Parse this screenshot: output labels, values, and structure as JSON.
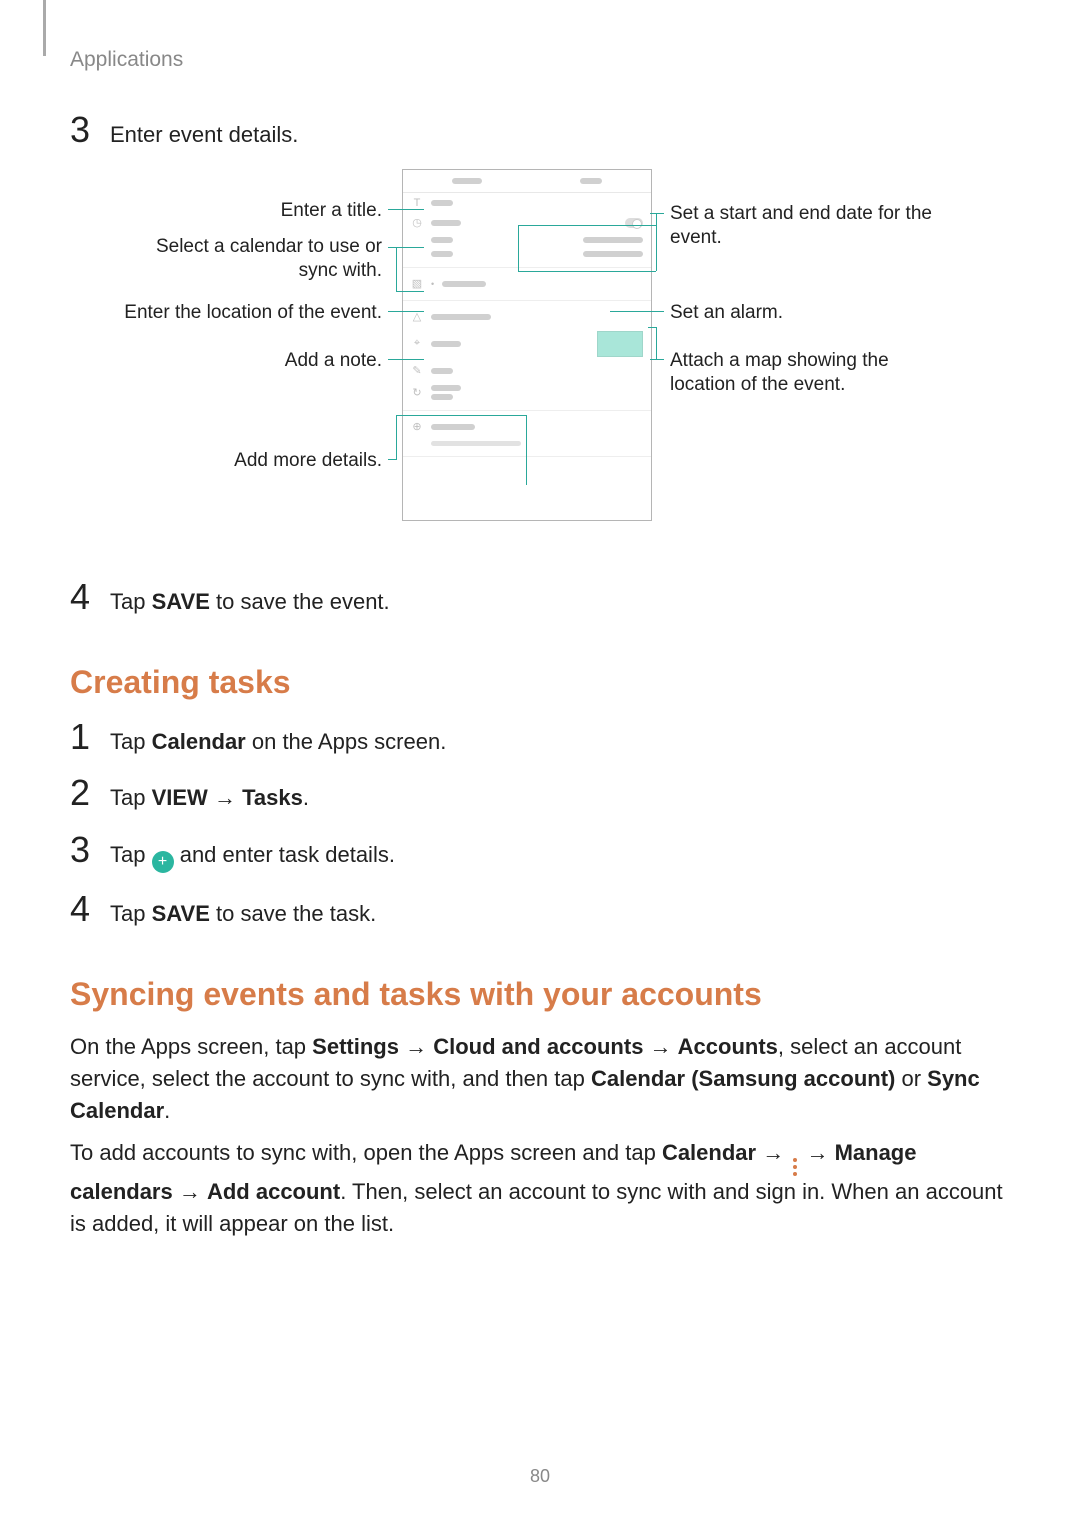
{
  "header": {
    "title": "Applications"
  },
  "step3": {
    "num": "3",
    "text": "Enter event details."
  },
  "callouts": {
    "enter_title": "Enter a title.",
    "select_calendar_l1": "Select a calendar to use or",
    "select_calendar_l2": "sync with.",
    "enter_location": "Enter the location of the event.",
    "add_note": "Add a note.",
    "add_more": "Add more details.",
    "set_date_l1": "Set a start and end date for the",
    "set_date_l2": "event.",
    "set_alarm": "Set an alarm.",
    "attach_map_l1": "Attach a map showing the",
    "attach_map_l2": "location of the event."
  },
  "step4": {
    "num": "4",
    "pre": "Tap ",
    "bold": "SAVE",
    "post": " to save the event."
  },
  "creating_tasks": {
    "heading": "Creating tasks",
    "s1": {
      "num": "1",
      "pre": "Tap ",
      "bold": "Calendar",
      "post": " on the Apps screen."
    },
    "s2": {
      "num": "2",
      "pre": "Tap ",
      "b1": "VIEW",
      "arrow": " → ",
      "b2": "Tasks",
      "post": "."
    },
    "s3": {
      "num": "3",
      "pre": "Tap ",
      "post": " and enter task details."
    },
    "s4": {
      "num": "4",
      "pre": "Tap ",
      "bold": "SAVE",
      "post": " to save the task."
    }
  },
  "syncing": {
    "heading": "Syncing events and tasks with your accounts",
    "p1_a": "On the Apps screen, tap ",
    "p1_b1": "Settings",
    "p1_arr": " → ",
    "p1_b2": "Cloud and accounts",
    "p1_b3": "Accounts",
    "p1_c": ", select an account service, select the account to sync with, and then tap ",
    "p1_b4": "Calendar (Samsung account)",
    "p1_or": " or ",
    "p1_b5": "Sync Calendar",
    "p1_end": ".",
    "p2_a": "To add accounts to sync with, open the Apps screen and tap ",
    "p2_b1": "Calendar",
    "p2_arr": " → ",
    "p2_b2": "Manage calendars",
    "p2_b3": "Add account",
    "p2_c": ". Then, select an account to sync with and sign in. When an account is added, it will appear on the list."
  },
  "page_number": "80"
}
